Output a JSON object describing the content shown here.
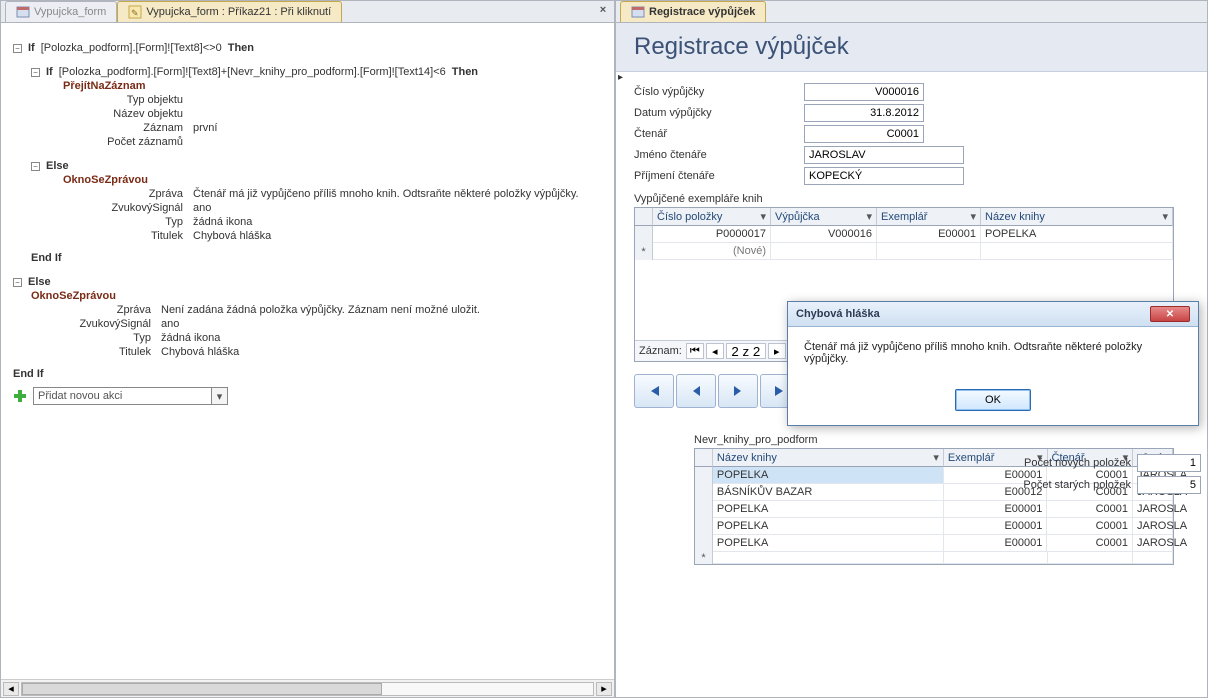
{
  "left": {
    "tabs": {
      "inactive": "Vypujcka_form",
      "active": "Vypujcka_form : Příkaz21 : Při kliknutí"
    },
    "macro": {
      "if1_kw": "If",
      "if1_expr": "[Polozka_podform].[Form]![Text8]<>0",
      "if1_then": "Then",
      "if2_kw": "If",
      "if2_expr": "[Polozka_podform].[Form]![Text8]+[Nevr_knihy_pro_podform].[Form]![Text14]<6",
      "if2_then": "Then",
      "cmd_goto": "PřejítNaZáznam",
      "goto_rows": [
        {
          "k": "Typ objektu",
          "v": ""
        },
        {
          "k": "Název objektu",
          "v": ""
        },
        {
          "k": "Záznam",
          "v": "první"
        },
        {
          "k": "Počet záznamů",
          "v": ""
        }
      ],
      "else_kw": "Else",
      "cmd_msg": "OknoSeZprávou",
      "msg1": [
        {
          "k": "Zpráva",
          "v": "Čtenář má již vypůjčeno příliš mnoho knih. Odtsraňte některé položky výpůjčky."
        },
        {
          "k": "ZvukovýSignál",
          "v": "ano"
        },
        {
          "k": "Typ",
          "v": "žádná ikona"
        },
        {
          "k": "Titulek",
          "v": "Chybová hláška"
        }
      ],
      "endif": "End If",
      "msg2": [
        {
          "k": "Zpráva",
          "v": "Není zadána žádná položka výpůjčky. Záznam není možné uložit."
        },
        {
          "k": "ZvukovýSignál",
          "v": "ano"
        },
        {
          "k": "Typ",
          "v": "žádná ikona"
        },
        {
          "k": "Titulek",
          "v": "Chybová hláška"
        }
      ],
      "add_placeholder": "Přidat novou akci"
    }
  },
  "right": {
    "tab": "Registrace výpůjček",
    "title": "Registrace výpůjček",
    "fields": {
      "cislo_l": "Číslo výpůjčky",
      "cislo_v": "V000016",
      "datum_l": "Datum výpůjčky",
      "datum_v": "31.8.2012",
      "ctenar_l": "Čtenář",
      "ctenar_v": "C0001",
      "jmeno_l": "Jméno čtenáře",
      "jmeno_v": "JAROSLAV",
      "prijmeni_l": "Příjmení čtenáře",
      "prijmeni_v": "KOPECKÝ"
    },
    "grid1": {
      "label": "Vypůjčené exempláře knih",
      "heads": [
        "Číslo položky",
        "Výpůjčka",
        "Exemplář",
        "Název knihy"
      ],
      "rows": [
        {
          "c1": "P0000017",
          "c2": "V000016",
          "c3": "E00001",
          "c4": "POPELKA"
        }
      ],
      "newrow": "(Nové)",
      "recnav": {
        "label": "Záznam:",
        "pos": "2 z 2"
      }
    },
    "counts": {
      "new_l": "Počet nových položek",
      "new_v": "1",
      "old_l": "Počet starých položek",
      "old_v": "5"
    },
    "grid2": {
      "label": "Nevr_knihy_pro_podform",
      "heads": [
        "Název knihy",
        "Exemplář",
        "Čtenář",
        "Jmé"
      ],
      "rows": [
        {
          "c1": "POPELKA",
          "c2": "E00001",
          "c3": "C0001",
          "c4": "JAROSLA",
          "sel": true
        },
        {
          "c1": "BÁSNÍKŮV BAZAR",
          "c2": "E00012",
          "c3": "C0001",
          "c4": "JAROSLA"
        },
        {
          "c1": "POPELKA",
          "c2": "E00001",
          "c3": "C0001",
          "c4": "JAROSLA"
        },
        {
          "c1": "POPELKA",
          "c2": "E00001",
          "c3": "C0001",
          "c4": "JAROSLA"
        },
        {
          "c1": "POPELKA",
          "c2": "E00001",
          "c3": "C0001",
          "c4": "JAROSLA"
        }
      ]
    },
    "dialog": {
      "title": "Chybová hláška",
      "text": "Čtenář má již vypůjčeno příliš mnoho knih. Odtsraňte některé položky výpůjčky.",
      "ok": "OK"
    }
  }
}
